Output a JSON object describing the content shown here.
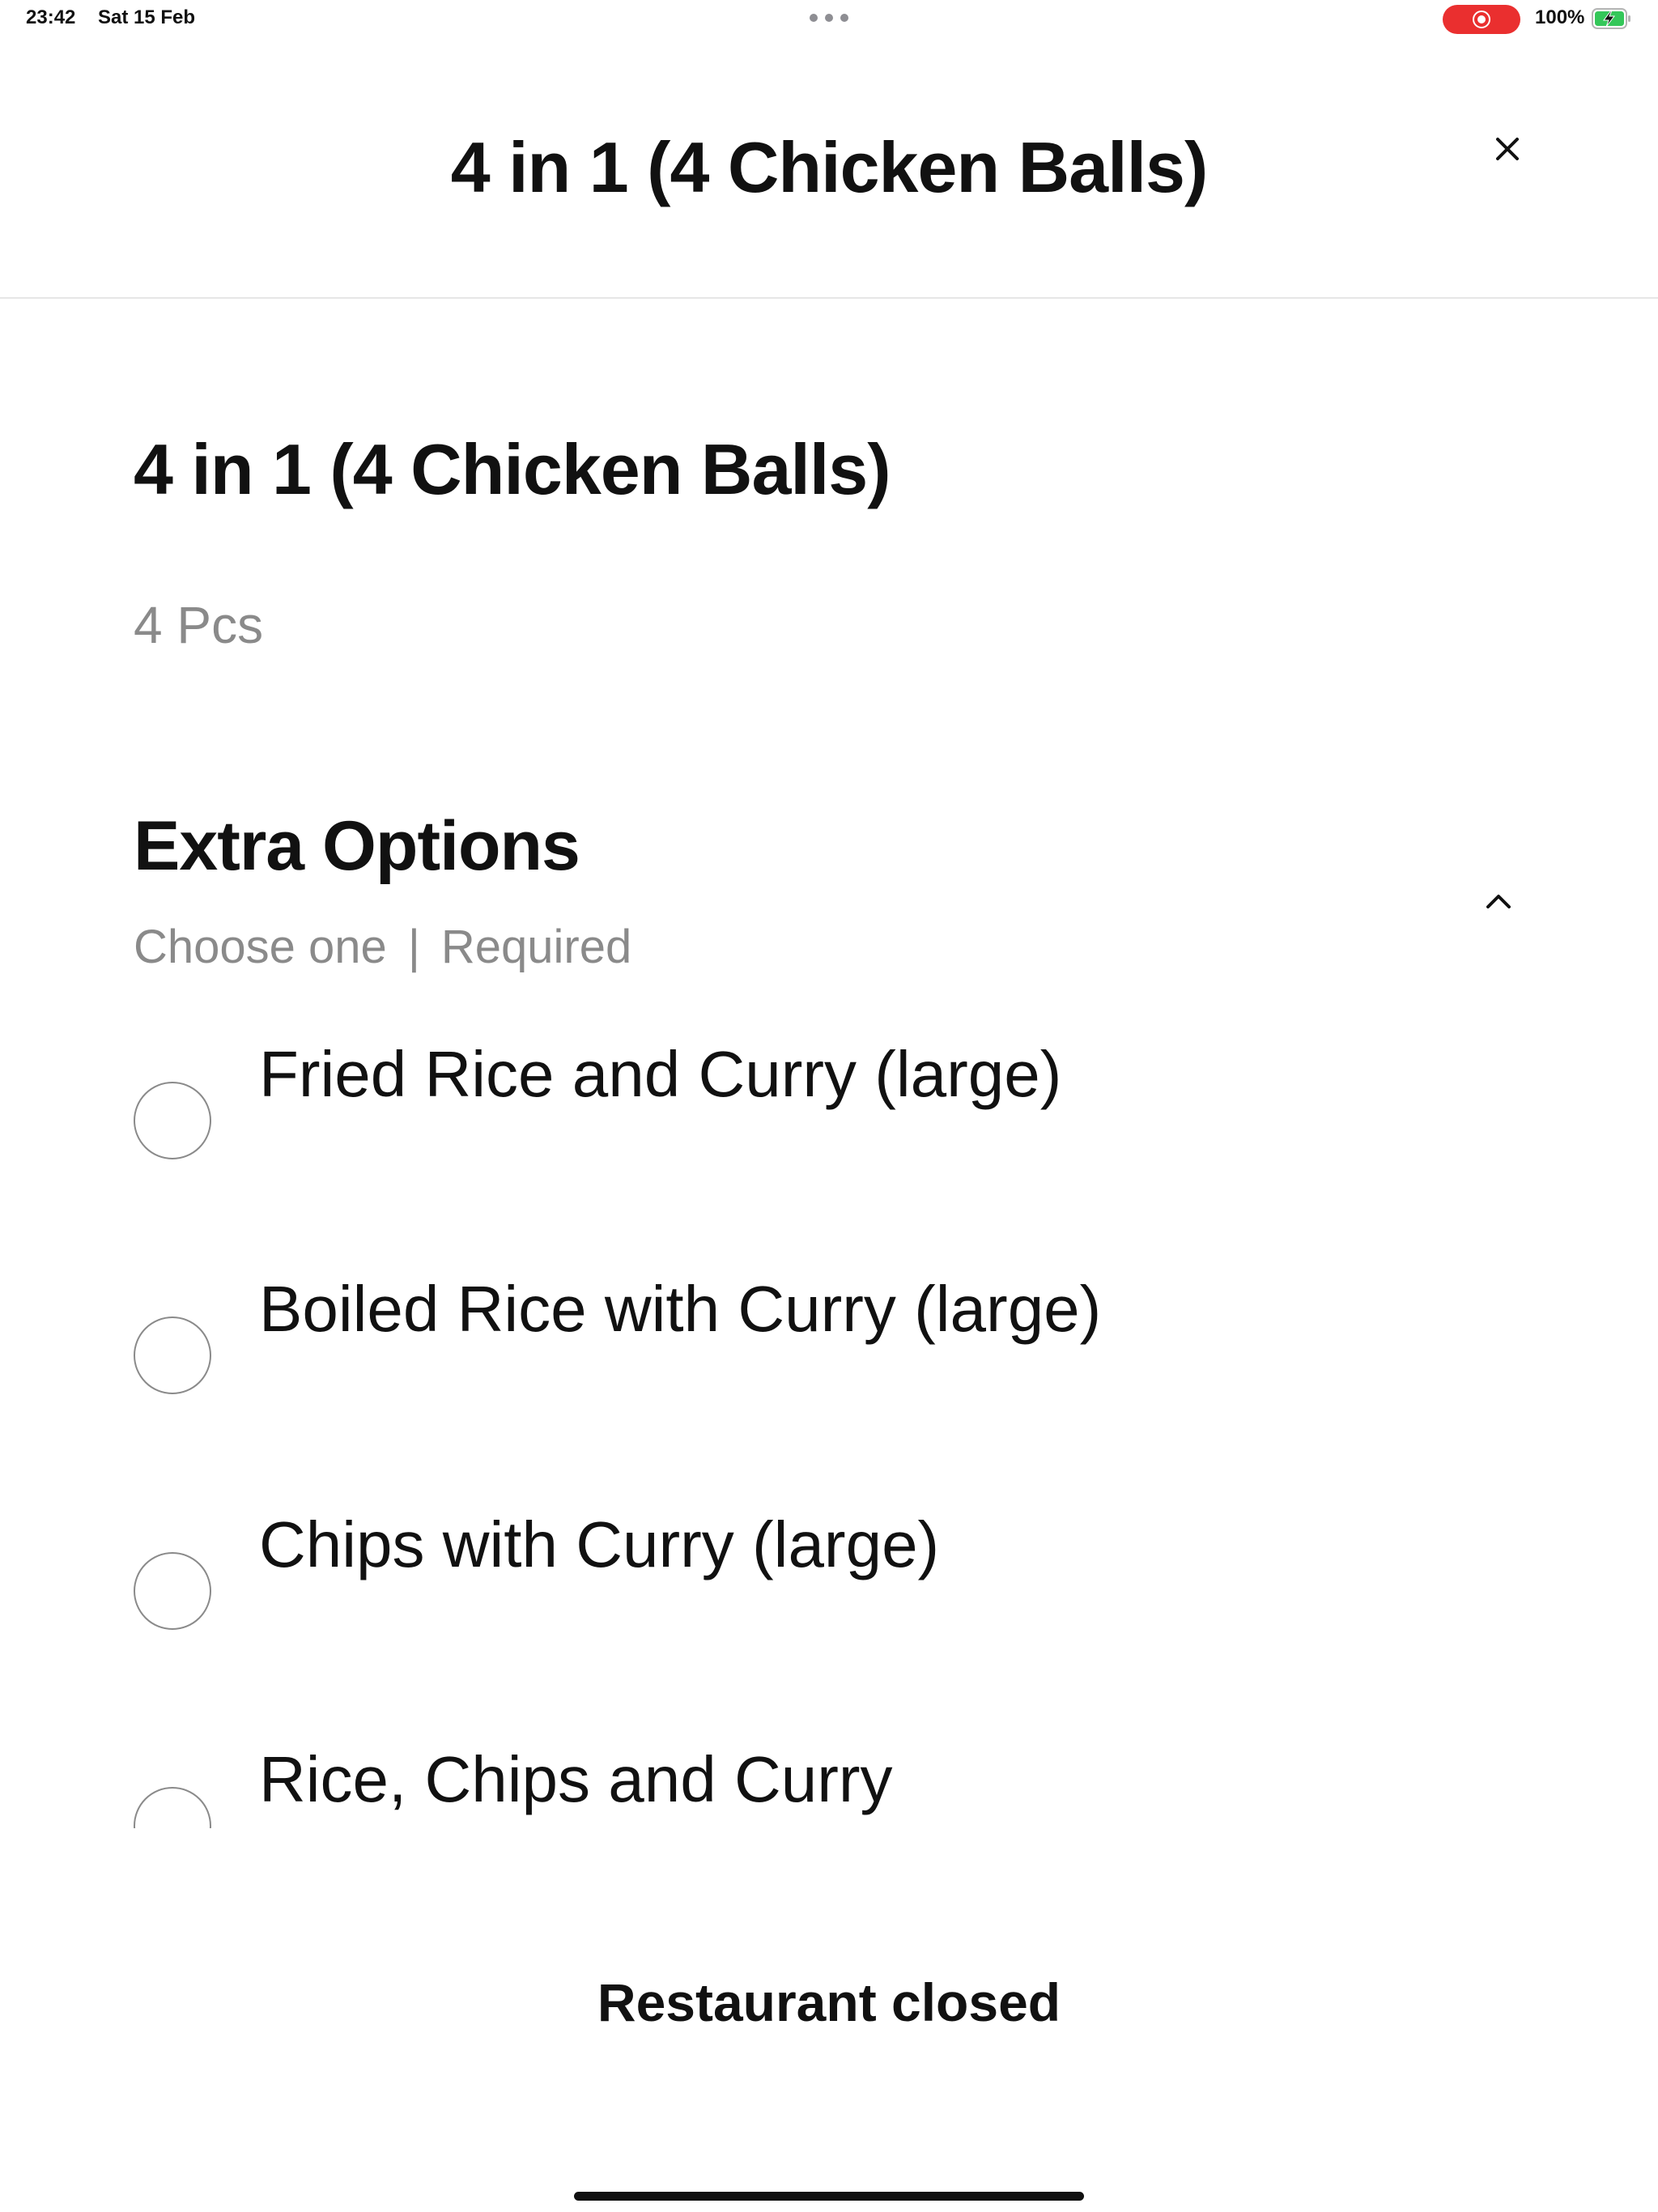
{
  "status_bar": {
    "time": "23:42",
    "date": "Sat 15 Feb",
    "battery_percent": "100%",
    "battery_level": 1.0,
    "charging": true,
    "screen_recording": true,
    "colors": {
      "recording": "#ea2f2f",
      "battery": "#34c759"
    }
  },
  "header": {
    "title": "4 in 1 (4 Chicken Balls)",
    "close_icon": "close-icon"
  },
  "item": {
    "title": "4 in 1 (4 Chicken Balls)",
    "description": "4 Pcs"
  },
  "extra_options": {
    "title": "Extra Options",
    "choose_label": "Choose one",
    "separator": "|",
    "required_label": "Required",
    "collapse_icon": "chevron-up-icon",
    "options": [
      {
        "label": "Fried Rice and Curry (large)",
        "selected": false
      },
      {
        "label": "Boiled Rice with Curry (large)",
        "selected": false
      },
      {
        "label": "Chips with Curry (large)",
        "selected": false
      },
      {
        "label": "Rice, Chips and Curry",
        "selected": false
      }
    ]
  },
  "footer": {
    "status": "Restaurant closed"
  }
}
